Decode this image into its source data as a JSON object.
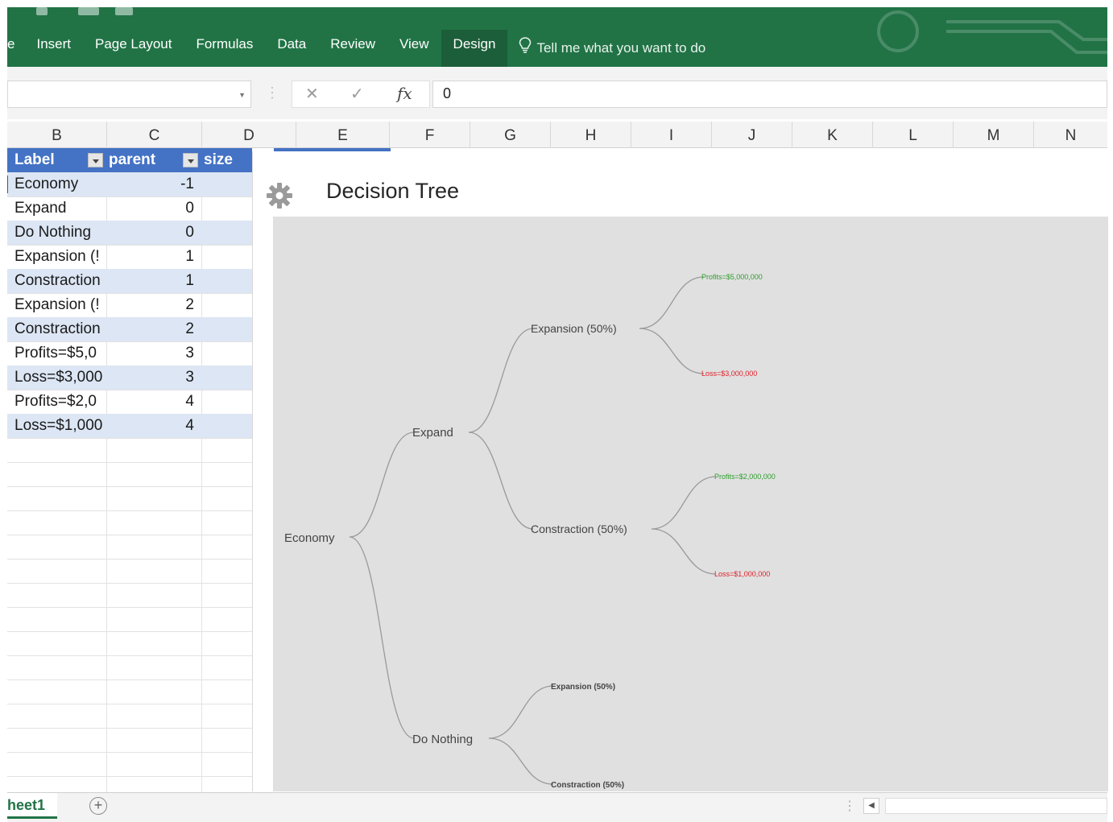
{
  "ribbon": {
    "tabs": [
      {
        "id": "file",
        "label": "e"
      },
      {
        "id": "insert",
        "label": "Insert"
      },
      {
        "id": "page_layout",
        "label": "Page Layout"
      },
      {
        "id": "formulas",
        "label": "Formulas"
      },
      {
        "id": "data",
        "label": "Data"
      },
      {
        "id": "review",
        "label": "Review"
      },
      {
        "id": "view",
        "label": "View"
      },
      {
        "id": "design",
        "label": "Design"
      }
    ],
    "active_tab": "Design",
    "tell_me": "Tell me what you want to do",
    "colors": {
      "ribbon": "#217346",
      "active_tab": "#1b5e39"
    }
  },
  "formula_bar": {
    "name_box": "",
    "cancel_icon": "close-icon",
    "enter_icon": "check-icon",
    "fx_label": "fx",
    "value": "0"
  },
  "columns": [
    "B",
    "C",
    "D",
    "E",
    "F",
    "G",
    "H",
    "I",
    "J",
    "K",
    "L",
    "M",
    "N"
  ],
  "table": {
    "headers": {
      "label": "Label",
      "parent": "parent",
      "size": "size"
    },
    "rows": [
      {
        "label": "Economy",
        "parent": "-1"
      },
      {
        "label": "Expand",
        "parent": "0"
      },
      {
        "label": "Do Nothing",
        "parent": "0"
      },
      {
        "label": "Expansion (!",
        "parent": "1"
      },
      {
        "label": "Constraction",
        "parent": "1"
      },
      {
        "label": "Expansion (!",
        "parent": "2"
      },
      {
        "label": "Constraction",
        "parent": "2"
      },
      {
        "label": "Profits=$5,0",
        "parent": "3"
      },
      {
        "label": "Loss=$3,000",
        "parent": "3"
      },
      {
        "label": "Profits=$2,0",
        "parent": "4"
      },
      {
        "label": "Loss=$1,000",
        "parent": "4"
      }
    ],
    "colors": {
      "header": "#4472c4",
      "band": "#dce6f4"
    }
  },
  "chart": {
    "title": "Decision Tree",
    "settings_icon": "gear-icon",
    "background": "#e0e0e0",
    "nodes": {
      "economy": "Economy",
      "expand": "Expand",
      "do_nothing": "Do Nothing",
      "expansion_1": "Expansion (50%)",
      "contraction_1": "Constraction (50%)",
      "profit_1": "Profits=$5,000,000",
      "loss_1": "Loss=$3,000,000",
      "profit_2": "Profits=$2,000,000",
      "loss_2": "Loss=$1,000,000",
      "expansion_2": "Expansion (50%)",
      "contraction_2": "Constraction (50%)"
    },
    "colors": {
      "profit": "#2e9e2e",
      "loss": "#e0202a",
      "link": "#9a9a9a",
      "text": "#444444"
    }
  },
  "sheetbar": {
    "sheet_tab": "heet1",
    "add_sheet_icon": "plus-circle-icon",
    "scroll_left_icon": "triangle-left-icon"
  }
}
